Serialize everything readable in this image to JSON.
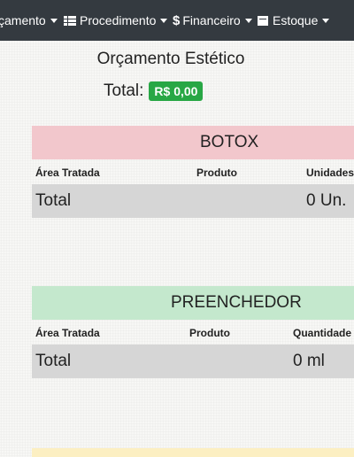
{
  "navbar": {
    "items": [
      {
        "label": "çamento",
        "icon": "caret"
      },
      {
        "label": "Procedimento",
        "icon": "list-icon"
      },
      {
        "label": "Financeiro",
        "icon": "dollar-icon"
      },
      {
        "label": "Estoque",
        "icon": "box-icon"
      }
    ]
  },
  "page": {
    "title": "Orçamento Estético",
    "total_label": "Total:",
    "total_value": "R$ 0,00"
  },
  "botox": {
    "title": "BOTOX",
    "columns": [
      "Área Tratada",
      "Produto",
      "Unidades"
    ],
    "total_label": "Total",
    "total_value": "0 Un."
  },
  "preenchedor": {
    "title": "PREENCHEDOR",
    "columns": [
      "Área Tratada",
      "Produto",
      "Quantidade"
    ],
    "total_label": "Total",
    "total_value": "0 ml"
  },
  "colors": {
    "navbar": "#343a40",
    "badge": "#28a745",
    "botox_header": "#f2c7cc",
    "preenchedor_header": "#c4e8cd",
    "total_row": "#d6d6d6"
  }
}
